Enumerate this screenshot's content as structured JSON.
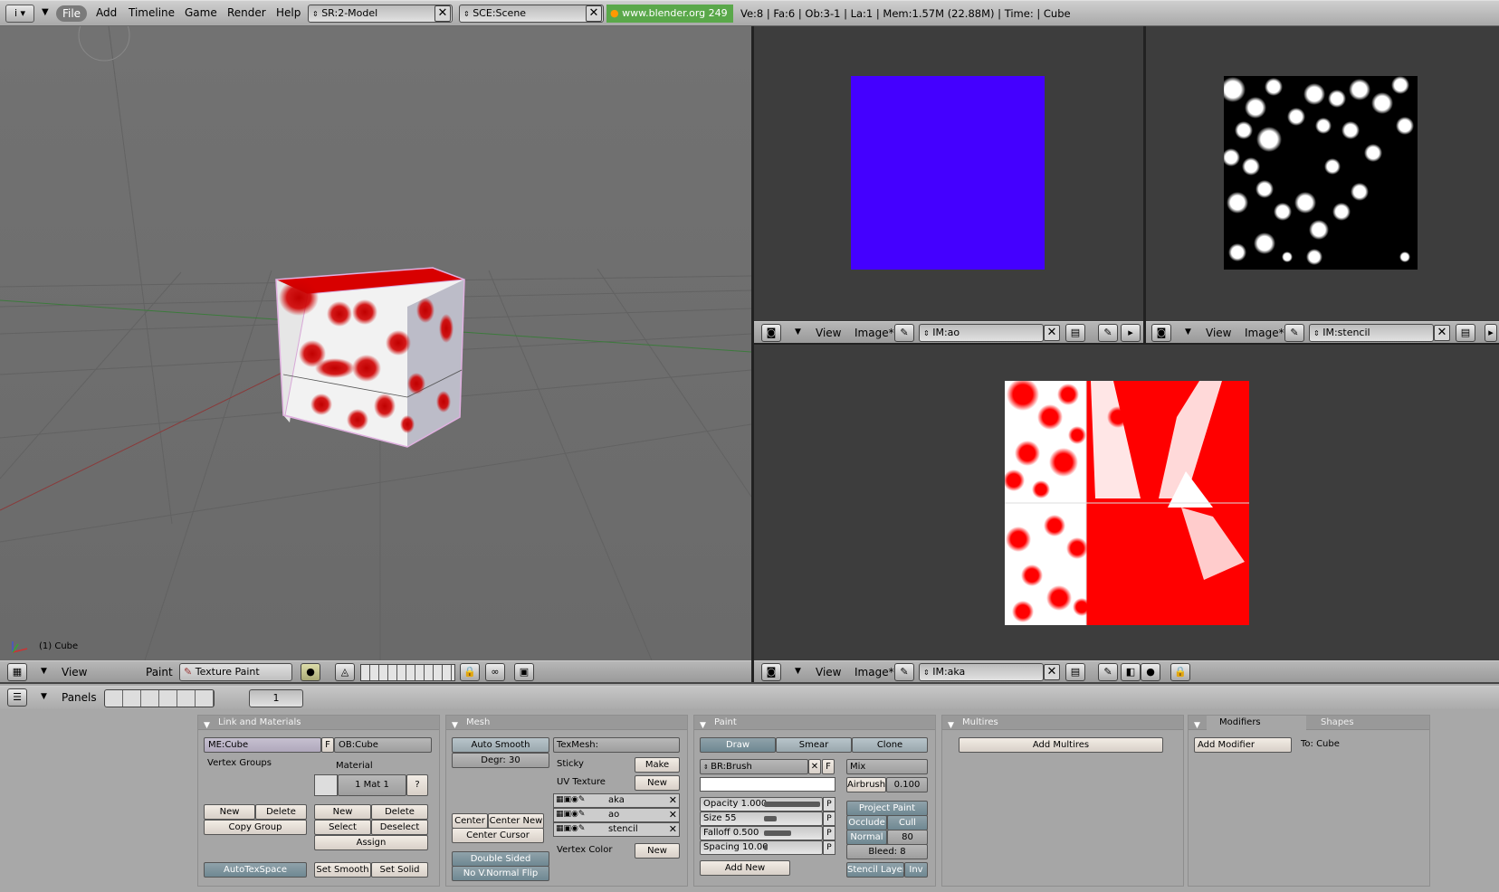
{
  "top_header": {
    "menus": [
      "File",
      "Add",
      "Timeline",
      "Game",
      "Render",
      "Help"
    ],
    "screen": "SR:2-Model",
    "scene": "SCE:Scene",
    "url": "www.blender.org 249",
    "stats": "Ve:8 | Fa:6 | Ob:3-1 | La:1  | Mem:1.57M (22.88M)  | Time: | Cube"
  },
  "viewport3d": {
    "object_label": "(1) Cube",
    "header": {
      "view": "View",
      "paint": "Paint",
      "mode": "Texture Paint"
    }
  },
  "image_editors": [
    {
      "view": "View",
      "image": "Image*",
      "name": "IM:ao",
      "color": "#4400ff"
    },
    {
      "view": "View",
      "image": "Image*",
      "name": "IM:stencil"
    },
    {
      "view": "View",
      "image": "Image*",
      "name": "IM:aka"
    }
  ],
  "buttons_header": {
    "panels": "Panels",
    "frame": "1"
  },
  "link_materials": {
    "title": "Link and Materials",
    "me": "ME:Cube",
    "f": "F",
    "ob": "OB:Cube",
    "vertex_groups": "Vertex Groups",
    "material": "Material",
    "mat_num": "1 Mat 1",
    "question": "?",
    "new": "New",
    "delete": "Delete",
    "copy_group": "Copy Group",
    "new2": "New",
    "delete2": "Delete",
    "select": "Select",
    "deselect": "Deselect",
    "assign": "Assign",
    "autotexspace": "AutoTexSpace",
    "set_smooth": "Set Smooth",
    "set_solid": "Set Solid"
  },
  "mesh": {
    "title": "Mesh",
    "auto_smooth": "Auto Smooth",
    "degr": "Degr: 30",
    "texmesh": "TexMesh:",
    "sticky": "Sticky",
    "make": "Make",
    "uv_texture": "UV Texture",
    "new": "New",
    "uv_layers": [
      "aka",
      "ao",
      "stencil"
    ],
    "center": "Center",
    "center_new": "Center New",
    "center_cursor": "Center Cursor",
    "vertex_color": "Vertex Color",
    "new2": "New",
    "double_sided": "Double Sided",
    "no_vnormal_flip": "No V.Normal Flip"
  },
  "paint": {
    "title": "Paint",
    "tabs": [
      "Draw",
      "Smear",
      "Clone"
    ],
    "brush": "BR:Brush",
    "f": "F",
    "blend": "Mix",
    "airbrush": "Airbrush",
    "airbrush_val": "0.100",
    "opacity": "Opacity 1.000",
    "size": "Size 55",
    "falloff": "Falloff 0.500",
    "spacing": "Spacing 10.00",
    "p": "P",
    "project_paint": "Project Paint",
    "occlude": "Occlude",
    "cull": "Cull",
    "normal": "Normal",
    "normal_val": "80",
    "bleed": "Bleed: 8",
    "add_new": "Add New",
    "stencil_layer": "Stencil Layer",
    "inv": "Inv"
  },
  "multires": {
    "title": "Multires",
    "add": "Add Multires"
  },
  "modifiers": {
    "tab1": "Modifiers",
    "tab2": "Shapes",
    "add": "Add Modifier",
    "to": "To: Cube"
  }
}
